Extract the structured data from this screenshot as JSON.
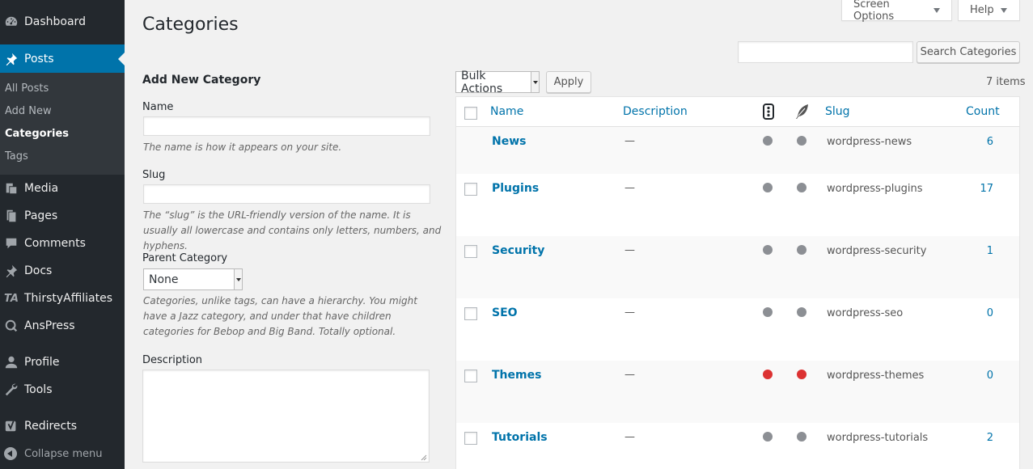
{
  "sidebar": {
    "items": [
      {
        "label": "Dashboard",
        "icon": "dashboard-icon"
      },
      {
        "label": "Posts",
        "icon": "pin-icon"
      },
      {
        "label": "Media",
        "icon": "media-icon"
      },
      {
        "label": "Pages",
        "icon": "pages-icon"
      },
      {
        "label": "Comments",
        "icon": "comment-icon"
      },
      {
        "label": "Docs",
        "icon": "pin-icon"
      },
      {
        "label": "ThirstyAffiliates",
        "icon": "thirstyaffiliates-icon"
      },
      {
        "label": "AnsPress",
        "icon": "anspress-icon"
      },
      {
        "label": "Profile",
        "icon": "user-icon"
      },
      {
        "label": "Tools",
        "icon": "wrench-icon"
      },
      {
        "label": "Redirects",
        "icon": "yoast-icon"
      }
    ],
    "submenu": [
      "All Posts",
      "Add New",
      "Categories",
      "Tags"
    ],
    "collapse_label": "Collapse menu",
    "accent": "#0073aa"
  },
  "header": {
    "screen_options": "Screen Options",
    "help": "Help",
    "title": "Categories",
    "search_button": "Search Categories",
    "search_value": ""
  },
  "form": {
    "heading": "Add New Category",
    "name_label": "Name",
    "name_value": "",
    "name_help": "The name is how it appears on your site.",
    "slug_label": "Slug",
    "slug_value": "",
    "slug_help": "The “slug” is the URL-friendly version of the name. It is usually all lowercase and contains only letters, numbers, and hyphens.",
    "parent_label": "Parent Category",
    "parent_value": "None",
    "parent_help": "Categories, unlike tags, can have a hierarchy. You might have a Jazz category, and under that have children categories for Bebop and Big Band. Totally optional.",
    "description_label": "Description",
    "description_value": ""
  },
  "toolbar": {
    "bulk_actions": "Bulk Actions",
    "apply": "Apply",
    "items_count": "7 items"
  },
  "table": {
    "columns": {
      "name": "Name",
      "description": "Description",
      "slug": "Slug",
      "count": "Count"
    },
    "status_colors": {
      "grey": "#8c8f94",
      "red": "#dc3232"
    },
    "rows": [
      {
        "name": "News",
        "description": "—",
        "status1": "grey",
        "status2": "grey",
        "slug": "wordpress-news",
        "count": "6"
      },
      {
        "name": "Plugins",
        "description": "—",
        "status1": "grey",
        "status2": "grey",
        "slug": "wordpress-plugins",
        "count": "17"
      },
      {
        "name": "Security",
        "description": "—",
        "status1": "grey",
        "status2": "grey",
        "slug": "wordpress-security",
        "count": "1"
      },
      {
        "name": "SEO",
        "description": "—",
        "status1": "grey",
        "status2": "grey",
        "slug": "wordpress-seo",
        "count": "0"
      },
      {
        "name": "Themes",
        "description": "—",
        "status1": "red",
        "status2": "red",
        "slug": "wordpress-themes",
        "count": "0"
      },
      {
        "name": "Tutorials",
        "description": "—",
        "status1": "grey",
        "status2": "grey",
        "slug": "wordpress-tutorials",
        "count": "2"
      }
    ]
  }
}
